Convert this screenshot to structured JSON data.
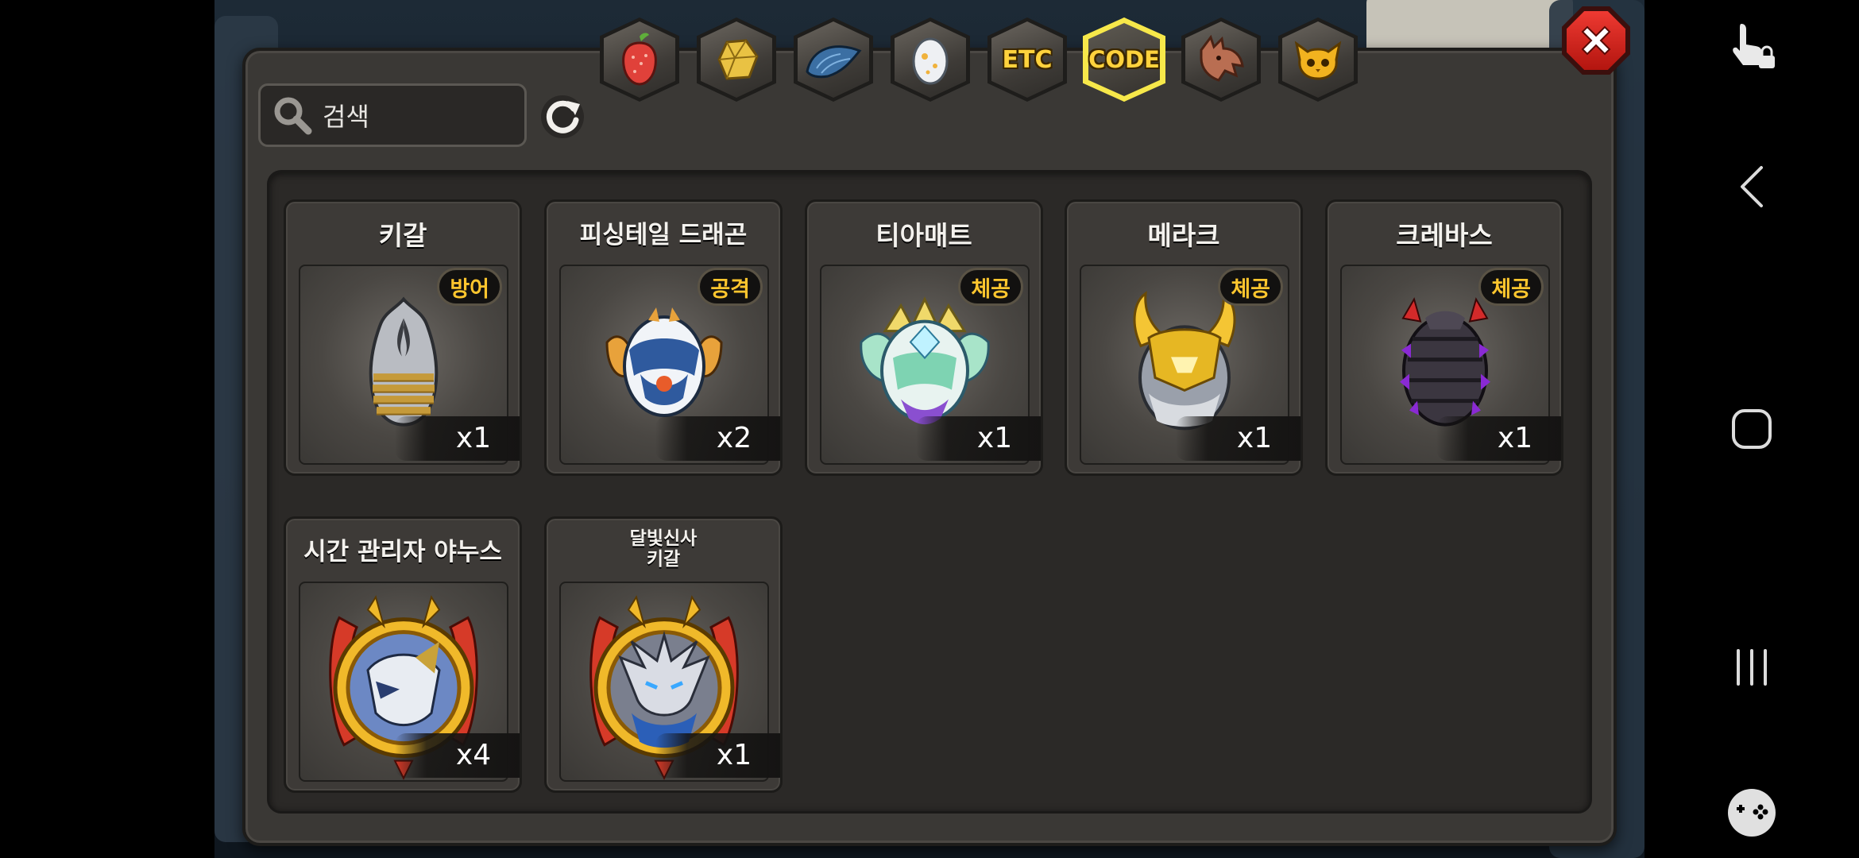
{
  "tabs": [
    {
      "id": "fruit",
      "icon": "fruit-icon",
      "label": ""
    },
    {
      "id": "material",
      "icon": "gold-ore-icon",
      "label": ""
    },
    {
      "id": "dragon-part",
      "icon": "dragon-scale-icon",
      "label": ""
    },
    {
      "id": "egg",
      "icon": "egg-icon",
      "label": ""
    },
    {
      "id": "etc",
      "icon": "",
      "label": "ETC"
    },
    {
      "id": "code",
      "icon": "",
      "label": "CODE",
      "active": true
    },
    {
      "id": "dragon",
      "icon": "dragon-head-icon",
      "label": ""
    },
    {
      "id": "pet",
      "icon": "owl-pet-icon",
      "label": ""
    }
  ],
  "search": {
    "text": "검색"
  },
  "items": [
    {
      "name": "키갈",
      "badge": "방어",
      "qty": "x1",
      "icon": "silver-egg-icon"
    },
    {
      "name": "피싱테일 드래곤",
      "badge": "공격",
      "qty": "x2",
      "icon": "blue-white-egg-icon"
    },
    {
      "name": "티아매트",
      "badge": "체공",
      "qty": "x1",
      "icon": "crystal-egg-icon"
    },
    {
      "name": "메라크",
      "badge": "체공",
      "qty": "x1",
      "icon": "gold-horned-egg-icon"
    },
    {
      "name": "크레바스",
      "badge": "체공",
      "qty": "x1",
      "icon": "dark-spiked-egg-icon"
    },
    {
      "name": "시간 관리자 야누스",
      "badge": "",
      "qty": "x4",
      "icon": "janus-medallion-icon"
    },
    {
      "name": "달빛신사\n키갈",
      "badge": "",
      "qty": "x1",
      "icon": "moonlight-kigal-medallion-icon"
    }
  ],
  "colors": {
    "accent": "#ffd23d",
    "active_tab": "#f7e84a",
    "close": "#e02a22"
  }
}
